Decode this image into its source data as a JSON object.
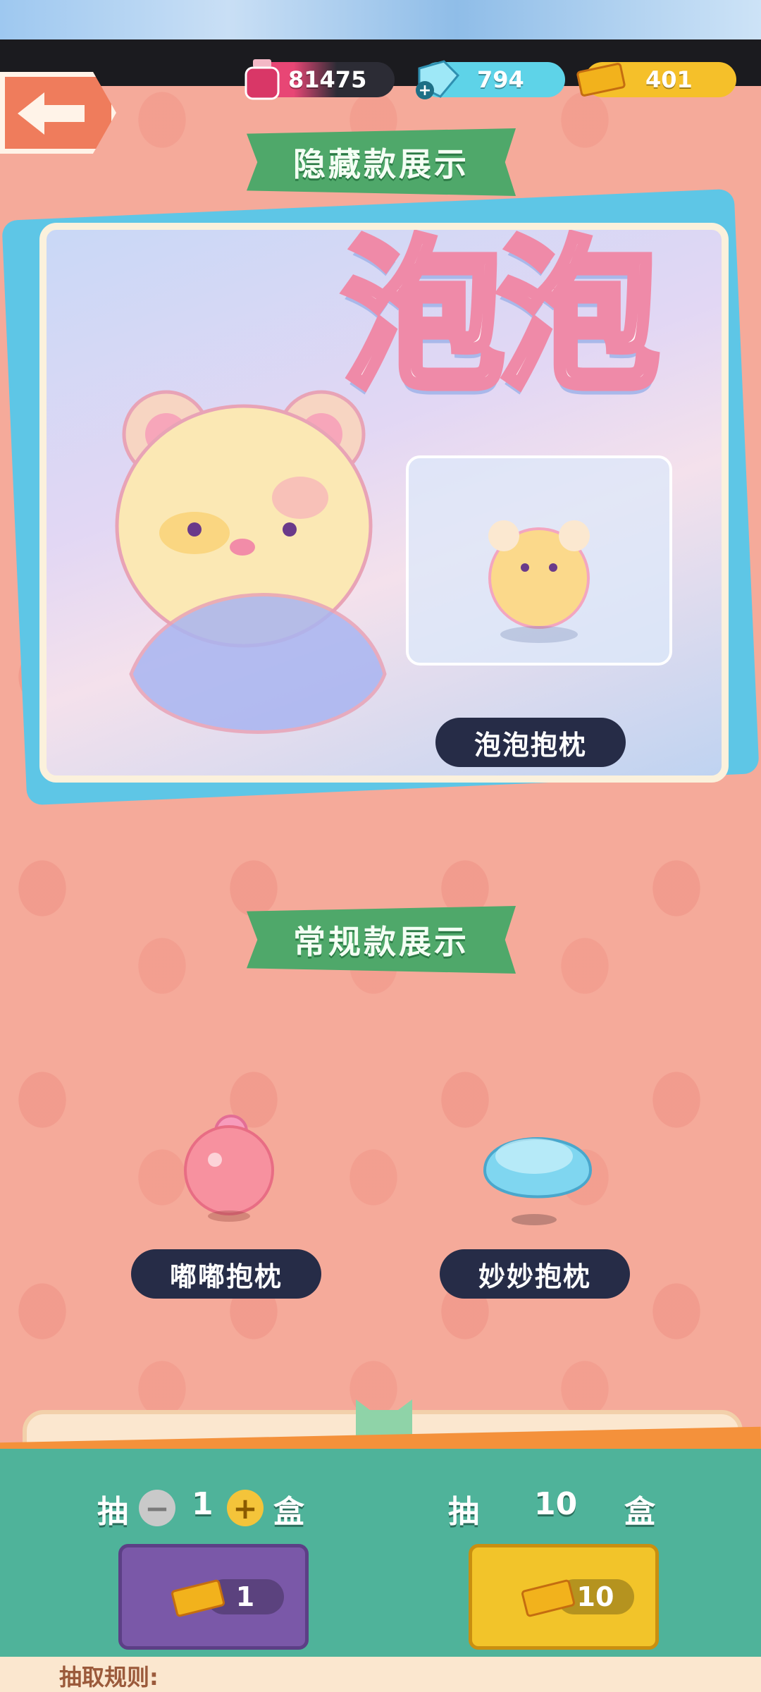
{
  "currencies": [
    {
      "name": "ink",
      "value": "81475",
      "icon": "ink-bottle-icon",
      "color": "#e84675"
    },
    {
      "name": "gems",
      "value": "794",
      "icon": "gem-plus-icon",
      "color": "#5ed3e8"
    },
    {
      "name": "tickets",
      "value": "401",
      "icon": "ticket-icon",
      "color": "#f5c02a"
    }
  ],
  "hidden_section": {
    "title": "隐藏款展示",
    "banner_text": "泡泡",
    "item_label": "泡泡抱枕"
  },
  "regular_section": {
    "title": "常规款展示",
    "items": [
      {
        "label": "嘟嘟抱枕",
        "icon": "pink-pillow-icon"
      },
      {
        "label": "妙妙抱枕",
        "icon": "blue-pillow-icon"
      }
    ]
  },
  "draw": {
    "single": {
      "prefix": "抽",
      "qty": "1",
      "suffix": "盒",
      "cost": "1",
      "minus": "−",
      "plus": "+"
    },
    "multi": {
      "prefix": "抽",
      "qty": "10",
      "suffix": "盒",
      "cost": "10"
    }
  },
  "rules_label": "抽取规则:"
}
